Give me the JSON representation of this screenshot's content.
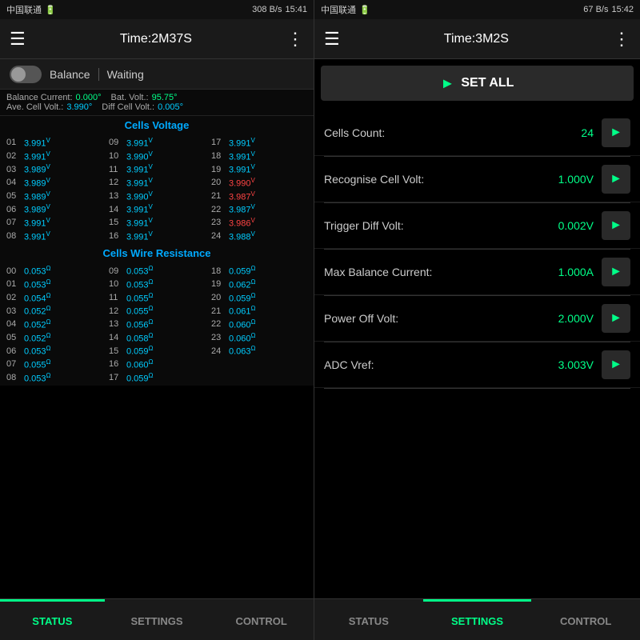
{
  "left": {
    "statusBar": {
      "carrier": "中国联通",
      "signal": "U",
      "speed": "308 B/s",
      "bluetooth": "✱",
      "wifi": "❋",
      "bars": "▌▌▌",
      "battery": "▓▓",
      "time": "15:41"
    },
    "topBar": {
      "time": "Time:2M37S",
      "menuIcon": "☰",
      "dotsIcon": "⋮"
    },
    "toggleRow": {
      "label": "Balance",
      "status": "Waiting"
    },
    "infoRow": {
      "balanceCurrent": "Balance Current:0.000°",
      "batVolt": "Bat. Volt.:95.75°",
      "aveCellVolt": "Ave. Cell Volt.:3.990°",
      "diffCellVolt": "Diff Cell Volt.:0.005°"
    },
    "cellsVoltageHeader": "Cells Voltage",
    "voltages": [
      {
        "num": "01",
        "val": "3.991",
        "sup": "V",
        "color": "cyan"
      },
      {
        "num": "09",
        "val": "3.991",
        "sup": "V",
        "color": "cyan"
      },
      {
        "num": "17",
        "val": "3.991",
        "sup": "V",
        "color": "cyan"
      },
      {
        "num": "02",
        "val": "3.991",
        "sup": "V",
        "color": "cyan"
      },
      {
        "num": "10",
        "val": "3.990",
        "sup": "V",
        "color": "cyan"
      },
      {
        "num": "18",
        "val": "3.991",
        "sup": "V",
        "color": "cyan"
      },
      {
        "num": "03",
        "val": "3.989",
        "sup": "V",
        "color": "cyan"
      },
      {
        "num": "11",
        "val": "3.991",
        "sup": "V",
        "color": "cyan"
      },
      {
        "num": "19",
        "val": "3.991",
        "sup": "V",
        "color": "cyan"
      },
      {
        "num": "04",
        "val": "3.989",
        "sup": "V",
        "color": "cyan"
      },
      {
        "num": "12",
        "val": "3.991",
        "sup": "V",
        "color": "cyan"
      },
      {
        "num": "20",
        "val": "3.990",
        "sup": "V",
        "color": "red"
      },
      {
        "num": "05",
        "val": "3.989",
        "sup": "V",
        "color": "cyan"
      },
      {
        "num": "13",
        "val": "3.990",
        "sup": "V",
        "color": "cyan"
      },
      {
        "num": "21",
        "val": "3.987",
        "sup": "V",
        "color": "red"
      },
      {
        "num": "06",
        "val": "3.989",
        "sup": "V",
        "color": "cyan"
      },
      {
        "num": "14",
        "val": "3.991",
        "sup": "V",
        "color": "cyan"
      },
      {
        "num": "22",
        "val": "3.987",
        "sup": "V",
        "color": "cyan"
      },
      {
        "num": "07",
        "val": "3.991",
        "sup": "V",
        "color": "cyan"
      },
      {
        "num": "15",
        "val": "3.991",
        "sup": "V",
        "color": "cyan"
      },
      {
        "num": "23",
        "val": "3.986",
        "sup": "V",
        "color": "red"
      },
      {
        "num": "08",
        "val": "3.991",
        "sup": "V",
        "color": "cyan"
      },
      {
        "num": "16",
        "val": "3.991",
        "sup": "V",
        "color": "cyan"
      },
      {
        "num": "24",
        "val": "3.988",
        "sup": "V",
        "color": "cyan"
      }
    ],
    "wireResistanceHeader": "Cells Wire Resistance",
    "resistances": [
      {
        "num": "00",
        "val": "0.053",
        "sup": "Ω"
      },
      {
        "num": "09",
        "val": "0.053",
        "sup": "Ω"
      },
      {
        "num": "18",
        "val": "0.059",
        "sup": "Ω"
      },
      {
        "num": "01",
        "val": "0.053",
        "sup": "Ω"
      },
      {
        "num": "10",
        "val": "0.053",
        "sup": "Ω"
      },
      {
        "num": "19",
        "val": "0.062",
        "sup": "Ω"
      },
      {
        "num": "02",
        "val": "0.054",
        "sup": "Ω"
      },
      {
        "num": "11",
        "val": "0.055",
        "sup": "Ω"
      },
      {
        "num": "20",
        "val": "0.059",
        "sup": "Ω"
      },
      {
        "num": "03",
        "val": "0.052",
        "sup": "Ω"
      },
      {
        "num": "12",
        "val": "0.055",
        "sup": "Ω"
      },
      {
        "num": "21",
        "val": "0.061",
        "sup": "Ω"
      },
      {
        "num": "04",
        "val": "0.052",
        "sup": "Ω"
      },
      {
        "num": "13",
        "val": "0.056",
        "sup": "Ω"
      },
      {
        "num": "22",
        "val": "0.060",
        "sup": "Ω"
      },
      {
        "num": "05",
        "val": "0.052",
        "sup": "Ω"
      },
      {
        "num": "14",
        "val": "0.058",
        "sup": "Ω"
      },
      {
        "num": "23",
        "val": "0.060",
        "sup": "Ω"
      },
      {
        "num": "06",
        "val": "0.053",
        "sup": "Ω"
      },
      {
        "num": "15",
        "val": "0.059",
        "sup": "Ω"
      },
      {
        "num": "24",
        "val": "0.063",
        "sup": "Ω"
      },
      {
        "num": "07",
        "val": "0.055",
        "sup": "Ω"
      },
      {
        "num": "16",
        "val": "0.060",
        "sup": "Ω"
      },
      {
        "num": "",
        "val": "",
        "sup": ""
      },
      {
        "num": "08",
        "val": "0.053",
        "sup": "Ω"
      },
      {
        "num": "17",
        "val": "0.059",
        "sup": "Ω"
      },
      {
        "num": "",
        "val": "",
        "sup": ""
      }
    ],
    "bottomNav": [
      {
        "label": "STATUS",
        "active": true
      },
      {
        "label": "SETTINGS",
        "active": false
      },
      {
        "label": "CONTROL",
        "active": false
      }
    ]
  },
  "right": {
    "statusBar": {
      "carrier": "中国联通",
      "signal": "U",
      "speed": "67 B/s",
      "bluetooth": "✱",
      "wifi": "❋",
      "bars": "▌▌▌",
      "battery": "▓▓",
      "time": "15:42"
    },
    "topBar": {
      "time": "Time:3M2S",
      "menuIcon": "☰",
      "dotsIcon": "⋮"
    },
    "setAllBtn": "SET ALL",
    "settings": [
      {
        "label": "Cells Count:",
        "value": "24"
      },
      {
        "label": "Recognise Cell Volt:",
        "value": "1.000V"
      },
      {
        "label": "Trigger Diff Volt:",
        "value": "0.002V"
      },
      {
        "label": "Max Balance Current:",
        "value": "1.000A"
      },
      {
        "label": "Power Off Volt:",
        "value": "2.000V"
      },
      {
        "label": "ADC Vref:",
        "value": "3.003V"
      }
    ],
    "bottomNav": [
      {
        "label": "STATUS",
        "active": false
      },
      {
        "label": "SETTINGS",
        "active": true
      },
      {
        "label": "CONTROL",
        "active": false
      }
    ]
  }
}
